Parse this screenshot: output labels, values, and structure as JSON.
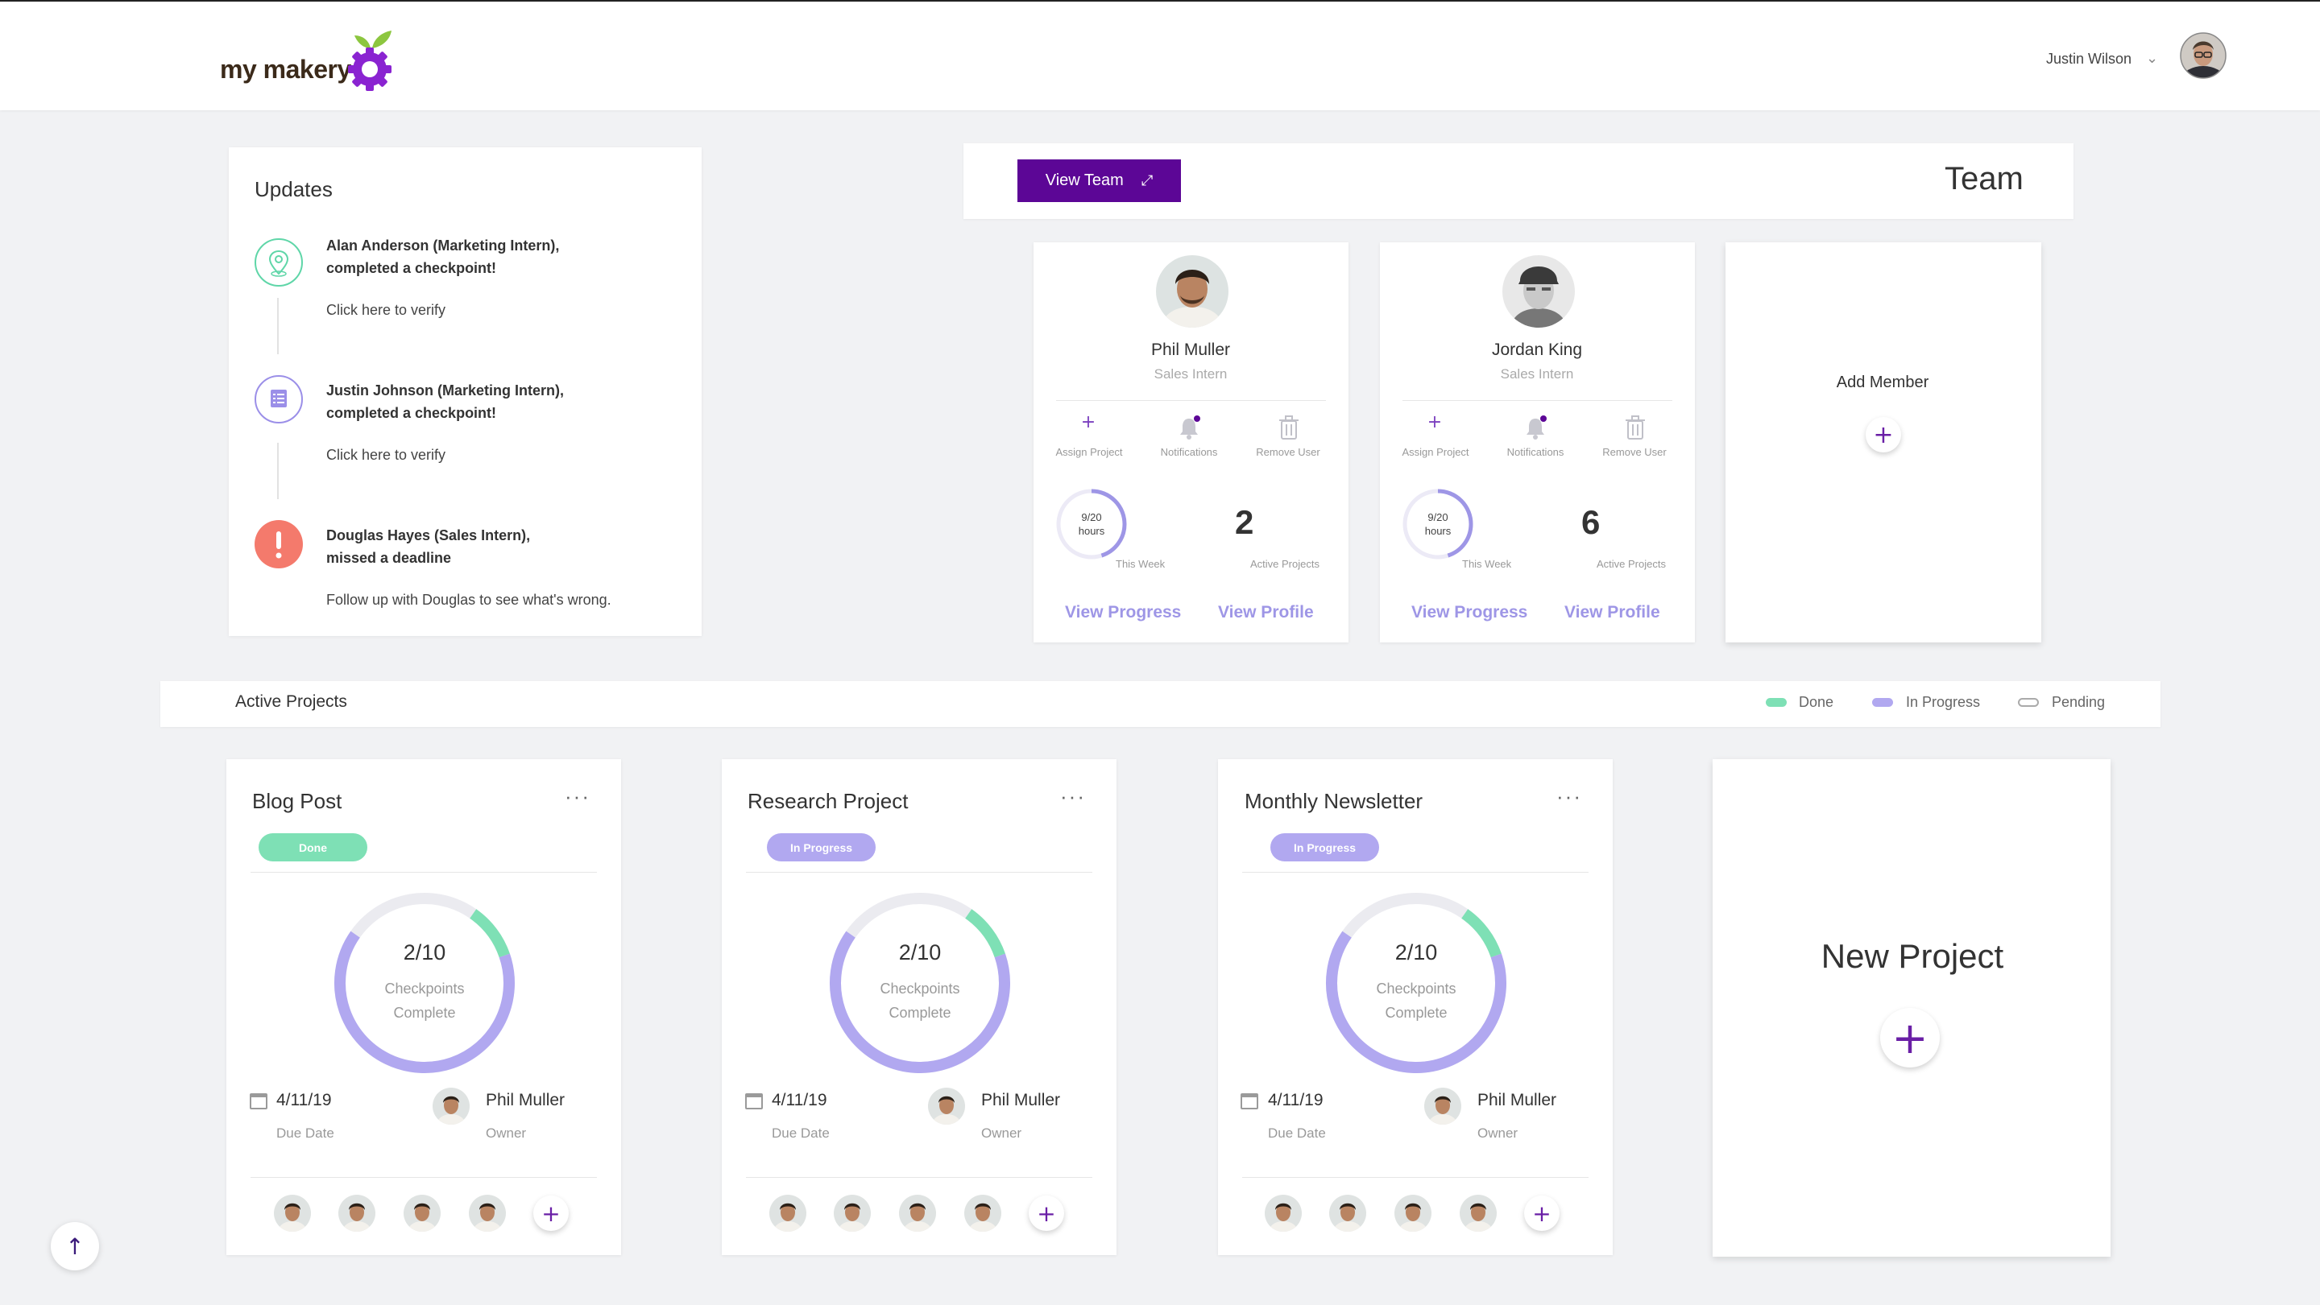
{
  "header": {
    "logo_text": "my makery",
    "user_name": "Justin Wilson"
  },
  "updates": {
    "title": "Updates",
    "items": [
      {
        "line1": "Alan Anderson (Marketing Intern),",
        "line2": "completed a checkpoint!",
        "action": "Click here to verify",
        "icon": "map-pin-icon",
        "color": "#5fd6a8"
      },
      {
        "line1": "Justin Johnson (Marketing Intern),",
        "line2": "completed a checkpoint!",
        "action": "Click here to verify",
        "icon": "list-icon",
        "color": "#9b8fe8"
      },
      {
        "line1": "Douglas Hayes (Sales Intern),",
        "line2": "missed a deadline",
        "action": "Follow up with Douglas to see what's wrong.",
        "icon": "alert-icon",
        "color": "#f47a6c"
      }
    ]
  },
  "team": {
    "view_team_label": "View Team",
    "title": "Team",
    "members": [
      {
        "name": "Phil Muller",
        "role": "Sales Intern",
        "hours": "9/20",
        "hours_unit": "hours",
        "hours_caption": "This Week",
        "hours_fraction": 0.45,
        "active_projects": "2",
        "active_caption": "Active Projects",
        "view_progress": "View Progress",
        "view_profile": "View Profile"
      },
      {
        "name": "Jordan King",
        "role": "Sales Intern",
        "hours": "9/20",
        "hours_unit": "hours",
        "hours_caption": "This Week",
        "hours_fraction": 0.45,
        "active_projects": "6",
        "active_caption": "Active Projects",
        "view_progress": "View Progress",
        "view_profile": "View Profile"
      }
    ],
    "actions": {
      "assign": "Assign Project",
      "notifications": "Notifications",
      "remove": "Remove User"
    },
    "add_member_label": "Add Member"
  },
  "active_projects": {
    "title": "Active Projects",
    "legend": [
      {
        "label": "Done",
        "color": "#7ee0b5"
      },
      {
        "label": "In Progress",
        "color": "#b1a8f0"
      },
      {
        "label": "Pending",
        "color": "#ffffff"
      }
    ],
    "projects": [
      {
        "title": "Blog Post",
        "status": "Done",
        "status_color": "#7ee0b5",
        "progress": "2/10",
        "progress_label_1": "Checkpoints",
        "progress_label_2": "Complete",
        "done_fraction": 0.1,
        "progress_fraction": 0.65,
        "due_date": "4/11/19",
        "due_label": "Due Date",
        "owner": "Phil Muller",
        "owner_label": "Owner"
      },
      {
        "title": "Research Project",
        "status": "In Progress",
        "status_color": "#b1a8f0",
        "progress": "2/10",
        "progress_label_1": "Checkpoints",
        "progress_label_2": "Complete",
        "done_fraction": 0.1,
        "progress_fraction": 0.65,
        "due_date": "4/11/19",
        "due_label": "Due Date",
        "owner": "Phil Muller",
        "owner_label": "Owner"
      },
      {
        "title": "Monthly Newsletter",
        "status": "In Progress",
        "status_color": "#b1a8f0",
        "progress": "2/10",
        "progress_label_1": "Checkpoints",
        "progress_label_2": "Complete",
        "done_fraction": 0.1,
        "progress_fraction": 0.65,
        "due_date": "4/11/19",
        "due_label": "Due Date",
        "owner": "Phil Muller",
        "owner_label": "Owner"
      }
    ],
    "new_project_label": "New Project"
  },
  "colors": {
    "brand_purple": "#5c0696",
    "link_lavender": "#9e96e6",
    "done_green": "#7ee0b5",
    "progress_lavender": "#b1a8f0",
    "pending_gray": "#ebebf0"
  }
}
